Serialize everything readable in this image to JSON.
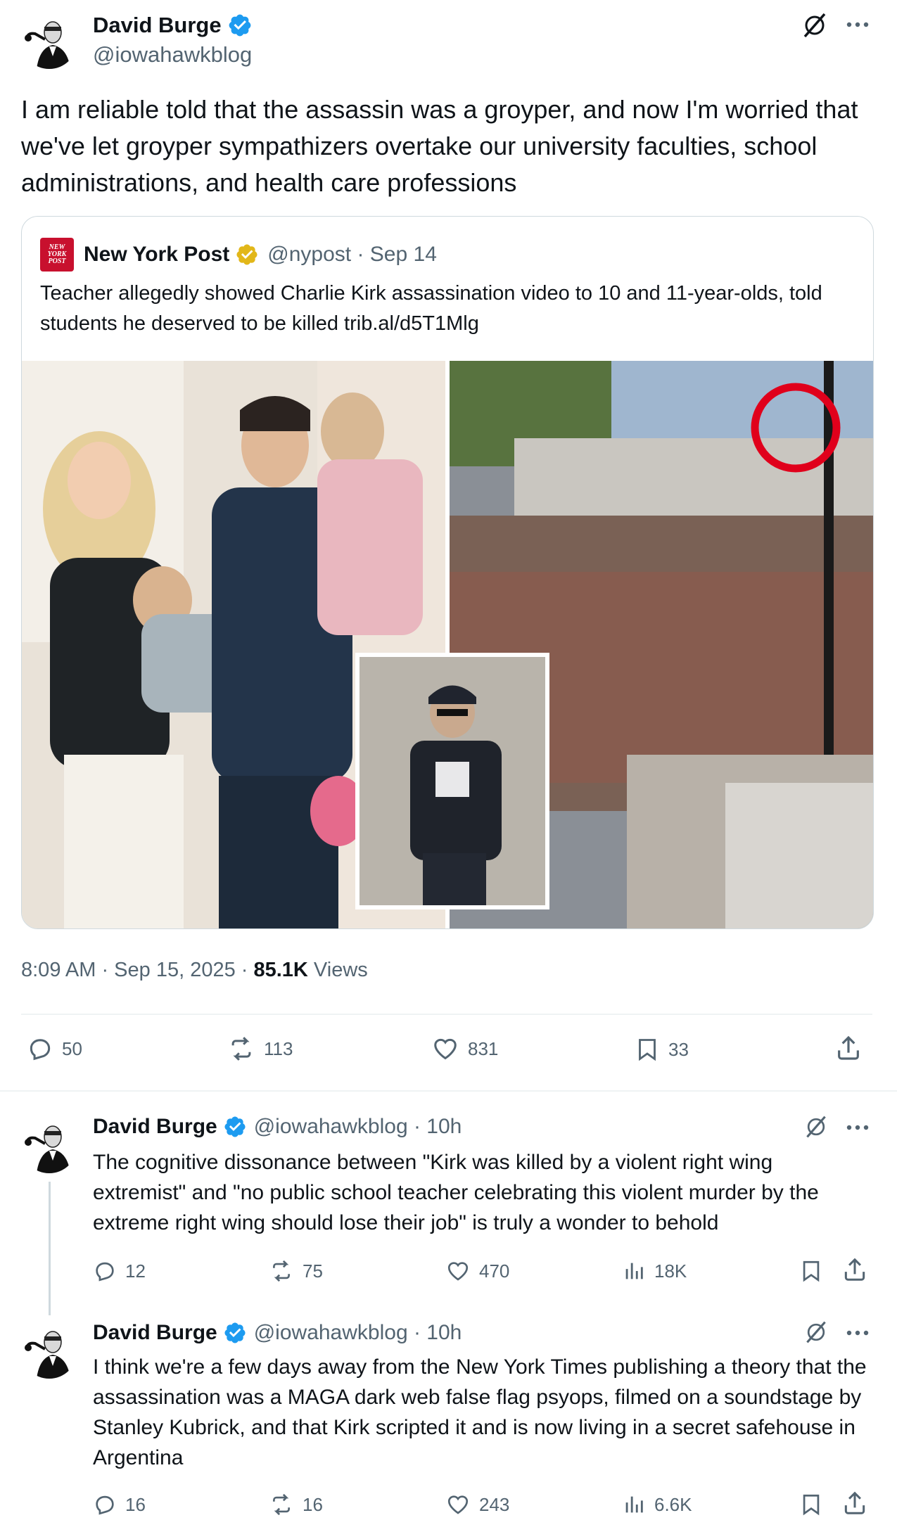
{
  "main_tweet": {
    "author_name": "David Burge",
    "author_handle": "@iowahawkblog",
    "text": "I am reliable told that the assassin was a groyper, and now I'm worried that we've let groyper sympathizers overtake our university faculties, school administrations, and health care professions",
    "timestamp": "8:09 AM · Sep 15, 2025 · ",
    "views_count": "85.1K",
    "views_label": " Views",
    "actions": {
      "replies": "50",
      "reposts": "113",
      "likes": "831",
      "bookmarks": "33"
    }
  },
  "quote": {
    "logo_text": "NEW YORK POST",
    "author_name": "New York Post",
    "handle_date": "@nypost · Sep 14",
    "text": "Teacher allegedly showed Charlie Kirk assassination video to 10 and 11-year-olds, told students he deserved to be killed trib.al/d5T1Mlg",
    "badge_color": "#e2b719"
  },
  "replies": [
    {
      "author_name": "David Burge",
      "handle_time": "@iowahawkblog · 10h",
      "text": "The cognitive dissonance between \"Kirk was killed by a violent right wing extremist\" and \"no public school teacher celebrating this violent murder by the extreme right wing should lose their job\" is truly a wonder to behold",
      "replies": "12",
      "reposts": "75",
      "likes": "470",
      "views": "18K"
    },
    {
      "author_name": "David Burge",
      "handle_time": "@iowahawkblog · 10h",
      "text": "I think we're a few days away from the New York Times publishing a theory that the assassination was a MAGA dark web false flag psyops, filmed on a soundstage by Stanley Kubrick, and that Kirk scripted it and is now living in a secret safehouse in Argentina",
      "replies": "16",
      "reposts": "16",
      "likes": "243",
      "views": "6.6K"
    }
  ],
  "colors": {
    "verified_blue": "#1d9bf0",
    "text": "#0f1419",
    "secondary": "#536471",
    "border": "#cfd9de"
  },
  "icons": [
    "grok-icon",
    "more-icon",
    "reply-icon",
    "repost-icon",
    "like-icon",
    "bookmark-icon",
    "share-icon",
    "views-icon",
    "verified-icon"
  ]
}
